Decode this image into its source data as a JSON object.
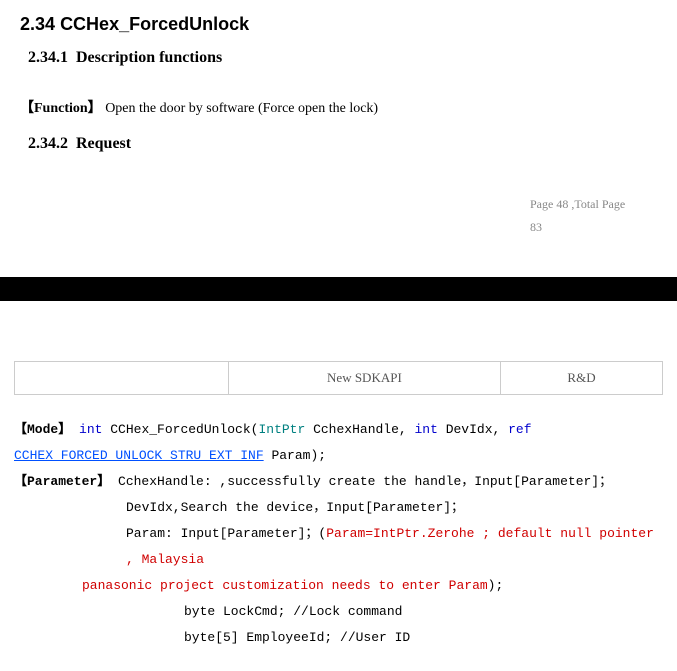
{
  "section": {
    "number": "2.34",
    "title": "CCHex_ForcedUnlock",
    "sub1": {
      "number": "2.34.1",
      "title": "Description functions"
    },
    "func_label": "【Function】",
    "func_text": "Open the door by software (Force open the lock)",
    "sub2": {
      "number": "2.34.2",
      "title": "Request"
    }
  },
  "pager": {
    "line1": "Page 48 ,Total Page",
    "line2": "83"
  },
  "header_table": {
    "col1": "",
    "col2": "New SDKAPI",
    "col3": "R&D"
  },
  "code": {
    "mode_label": "【Mode】",
    "kw_int": "int",
    "fn_name": " CCHex_ForcedUnlock(",
    "type_intptr": "IntPtr",
    "arg1": " CchexHandle, ",
    "kw_int2": "int",
    "arg2": " DevIdx, ",
    "kw_ref": "ref",
    "struct_type": "CCHEX_FORCED_UNLOCK_STRU_EXT_INF",
    "param_close": " Param);",
    "param_label": "【Parameter】",
    "p_cchex": " CchexHandle: ,successfully create the handle，Input[Parameter]；",
    "p_devidx": "DevIdx,Search the  device，Input[Parameter]；",
    "p_param_lead": "Param:       Input[Parameter]；(",
    "p_param_red1": "Param=IntPtr.Zerohe ; default null pointer , Malaysia",
    "p_param_red2": "panasonic project customization needs to enter Param",
    "p_param_tail": ");",
    "fld1": "byte     LockCmd;        //Lock command",
    "fld2": "byte[5]  EmployeeId;     //User ID"
  }
}
